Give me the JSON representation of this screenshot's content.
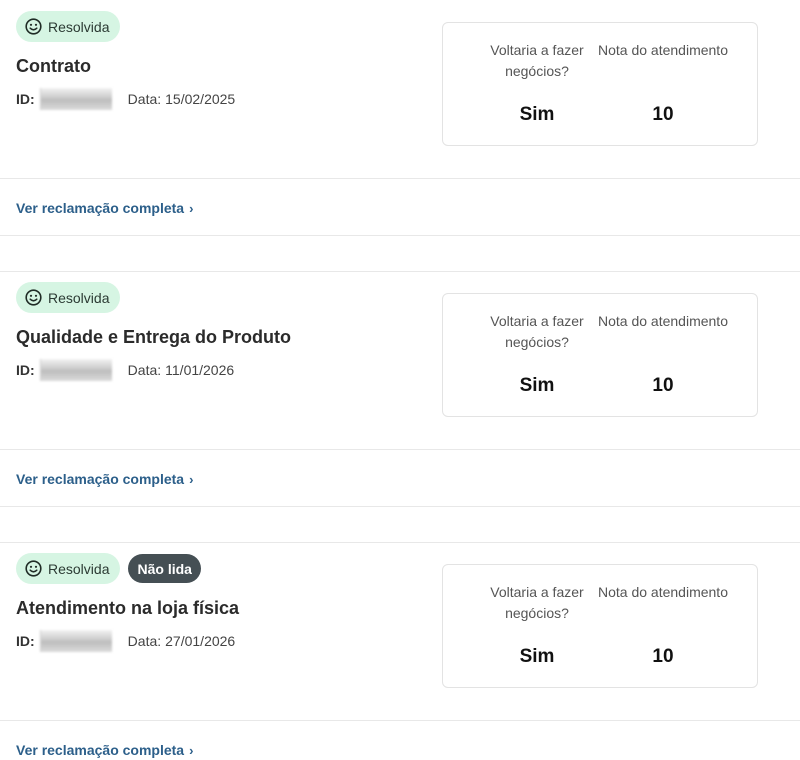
{
  "complaints": [
    {
      "status": "Resolvida",
      "unread": "",
      "title": "Contrato",
      "id_label": "ID:",
      "date_label": "Data:",
      "date": "15/02/2025",
      "stat1_label": "Voltaria a fazer negócios?",
      "stat1_value": "Sim",
      "stat2_label": "Nota do atendimento",
      "stat2_value": "10",
      "link": "Ver reclamação completa"
    },
    {
      "status": "Resolvida",
      "unread": "",
      "title": "Qualidade e Entrega do Produto",
      "id_label": "ID:",
      "date_label": "Data:",
      "date": "11/01/2026",
      "stat1_label": "Voltaria a fazer negócios?",
      "stat1_value": "Sim",
      "stat2_label": "Nota do atendimento",
      "stat2_value": "10",
      "link": "Ver reclamação completa"
    },
    {
      "status": "Resolvida",
      "unread": "Não lida",
      "title": "Atendimento na loja física",
      "id_label": "ID:",
      "date_label": "Data:",
      "date": "27/01/2026",
      "stat1_label": "Voltaria a fazer negócios?",
      "stat1_value": "Sim",
      "stat2_label": "Nota do atendimento",
      "stat2_value": "10",
      "link": "Ver reclamação completa"
    }
  ],
  "icons": {
    "status": "smile-icon",
    "link_arrow": "chevron-right-icon"
  },
  "colors": {
    "resolved_bg": "#d6f5e3",
    "unread_bg": "#454f54",
    "link": "#2c5f8a"
  }
}
